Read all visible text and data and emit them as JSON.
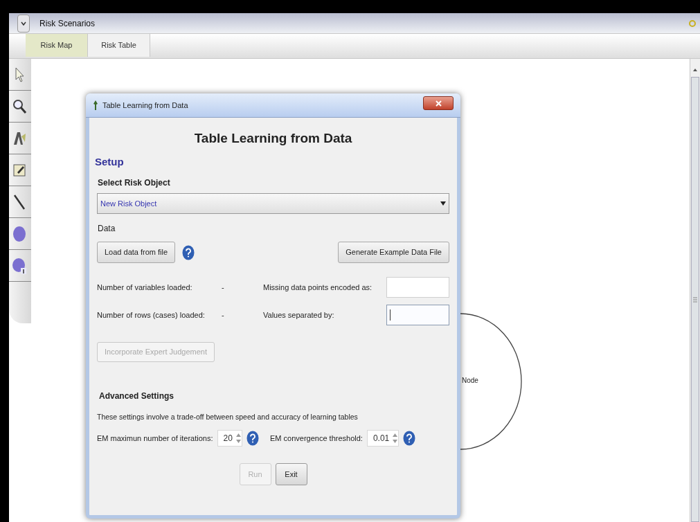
{
  "window": {
    "title": "Risk Scenarios"
  },
  "tabs": [
    {
      "label": "Risk Map",
      "selected": true
    },
    {
      "label": "Risk Table",
      "selected": false
    }
  ],
  "toolbar": {
    "tools": [
      {
        "kind": "pointer"
      },
      {
        "kind": "zoom"
      },
      {
        "kind": "text"
      },
      {
        "kind": "note"
      },
      {
        "kind": "line"
      },
      {
        "kind": "node"
      },
      {
        "kind": "input-node"
      }
    ]
  },
  "canvas": {
    "nodes": [
      {
        "label": "Node"
      }
    ]
  },
  "dialog": {
    "title": "Table Learning from Data",
    "heading": "Table Learning from Data",
    "section": "Setup",
    "select_label": "Select Risk Object",
    "select": {
      "value": "New Risk Object"
    },
    "data_label": "Data",
    "load_button": "Load data from file",
    "generate_button": "Generate Example Data File",
    "stats": [
      {
        "label": "Number of variables loaded:",
        "value": "-"
      },
      {
        "label": "Number of rows (cases) loaded:",
        "value": "-"
      }
    ],
    "inputs": [
      {
        "label": "Missing data points encoded as:",
        "focused": false
      },
      {
        "label": "Values separated by:",
        "focused": true
      }
    ],
    "expert_button": {
      "label": "Incorporate Expert Judgement",
      "disabled": true
    },
    "advanced": {
      "title": "Advanced Settings",
      "note": "These settings involve a trade-off between speed and accuracy of learning tables",
      "spinners": [
        {
          "label": "EM maximun number of iterations:",
          "value": "20"
        },
        {
          "label": "EM convergence threshold:",
          "value": "0.01"
        }
      ]
    },
    "buttons": [
      {
        "label": "Run",
        "disabled": true
      },
      {
        "label": "Exit",
        "disabled": false
      }
    ]
  }
}
